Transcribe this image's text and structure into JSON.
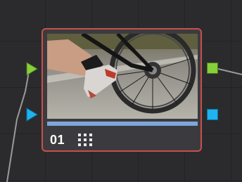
{
  "node": {
    "number": "01",
    "clip_icon": "clip-grid-icon",
    "thumbnail": "bicycle-wheel-and-shoe-clip",
    "progress": 1.0
  },
  "ports": {
    "input_rgb": {
      "icon": "triangle-right-icon",
      "color": "#86d03b"
    },
    "input_key": {
      "icon": "triangle-right-icon",
      "color": "#1eb3f0"
    },
    "output_rgb": {
      "icon": "square-icon",
      "color": "#86d03b"
    },
    "output_key": {
      "icon": "square-icon",
      "color": "#1eb3f0"
    }
  },
  "colors": {
    "node_border": "#c8504b",
    "node_body": "#3b3b3f",
    "progress": "#7da7da",
    "background": "#2b2b2e"
  }
}
